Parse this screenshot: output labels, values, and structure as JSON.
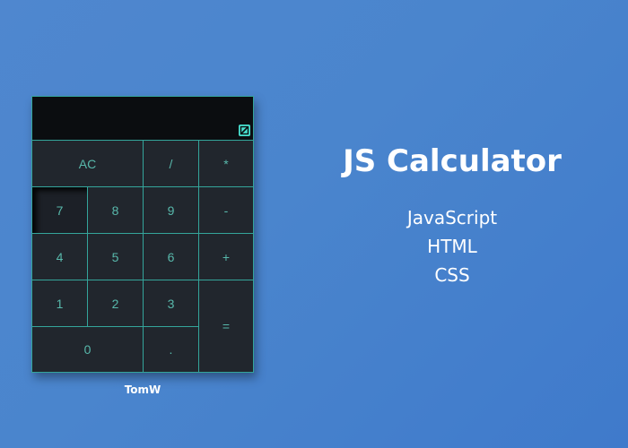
{
  "calculator": {
    "display_value": "",
    "toggle_icon": "minimize-icon",
    "keys": {
      "ac": "AC",
      "divide": "/",
      "multiply": "*",
      "seven": "7",
      "eight": "8",
      "nine": "9",
      "minus": "-",
      "four": "4",
      "five": "5",
      "six": "6",
      "plus": "+",
      "one": "1",
      "two": "2",
      "three": "3",
      "equals": "=",
      "zero": "0",
      "decimal": "."
    },
    "pressed_key": "7"
  },
  "credit": "TomW",
  "info": {
    "title": "JS Calculator",
    "technologies": [
      "JavaScript",
      "HTML",
      "CSS"
    ]
  },
  "colors": {
    "background": "#4a85cd",
    "calculator_body": "#21262d",
    "display": "#0b0d10",
    "accent": "#34a59b",
    "key_text": "#58b8ab"
  }
}
